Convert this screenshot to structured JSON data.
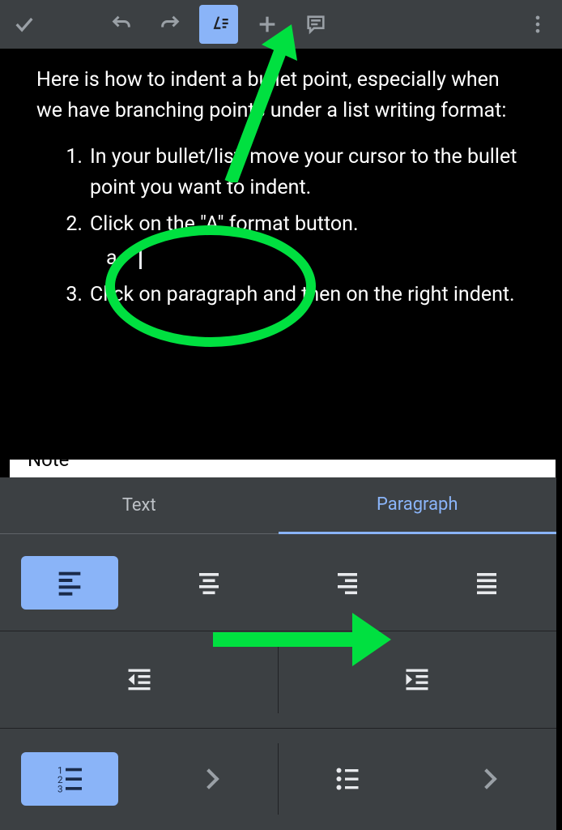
{
  "toolbar": {
    "accept_name": "accept-icon",
    "undo_name": "undo-icon",
    "redo_name": "redo-icon",
    "format_name": "text-format-icon",
    "insert_name": "plus-icon",
    "comment_name": "comment-icon",
    "overflow_name": "more-icon"
  },
  "document": {
    "intro": "Here is how to indent a bullet point, especially when we have branching points under a list writing format:",
    "steps": [
      "In your bullet/list, move your cursor to the bullet point you want to indent.",
      "Click on the \"A\" format button.",
      "Click on paragraph and then on the right indent."
    ],
    "sub_item_marker": "a."
  },
  "section_label": "Note",
  "panel": {
    "tabs": {
      "text": "Text",
      "paragraph": "Paragraph",
      "active": "paragraph"
    },
    "alignment": [
      {
        "name": "align-left",
        "active": true
      },
      {
        "name": "align-center",
        "active": false
      },
      {
        "name": "align-right",
        "active": false
      },
      {
        "name": "align-justify",
        "active": false
      }
    ],
    "indent": [
      {
        "name": "indent-decrease"
      },
      {
        "name": "indent-increase"
      }
    ],
    "lists": [
      {
        "name": "numbered-list",
        "active": true
      },
      {
        "name": "bullet-list",
        "active": false
      }
    ]
  },
  "annotations": {
    "arrow_color": "#00e040"
  }
}
